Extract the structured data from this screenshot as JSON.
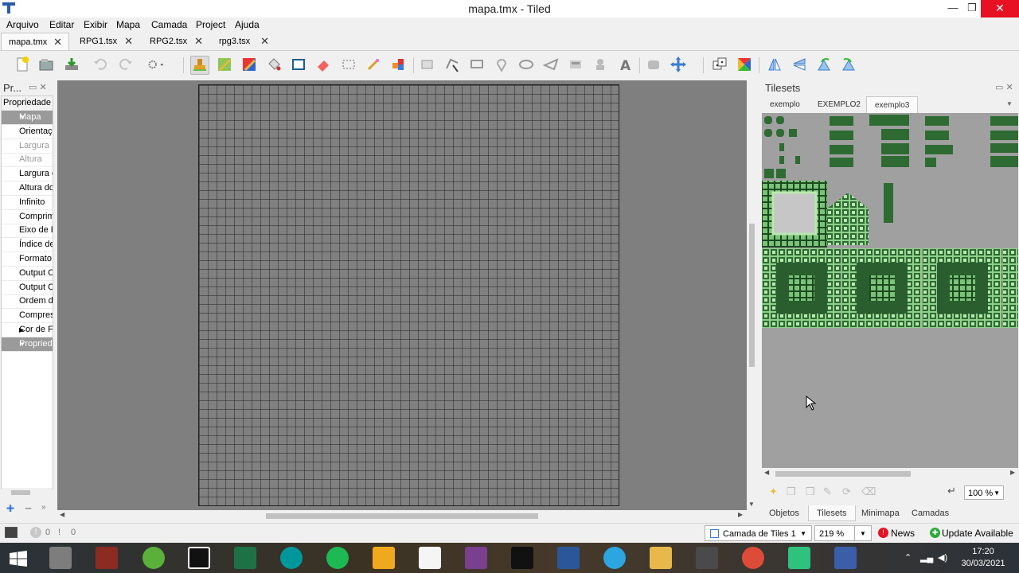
{
  "window": {
    "title": "mapa.tmx - Tiled",
    "controls": [
      "minimize-icon",
      "maximize-icon",
      "close-icon"
    ]
  },
  "menu": [
    "Arquivo",
    "Editar",
    "Exibir",
    "Mapa",
    "Camada",
    "Project",
    "Ajuda"
  ],
  "doc_tabs": [
    {
      "label": "mapa.tmx",
      "active": true
    },
    {
      "label": "RPG1.tsx",
      "active": false
    },
    {
      "label": "RPG2.tsx",
      "active": false
    },
    {
      "label": "rpg3.tsx",
      "active": false
    }
  ],
  "toolbar": {
    "icons": [
      "new-icon",
      "open-icon",
      "save-icon",
      "undo-icon",
      "redo-icon",
      "commands-icon",
      "stamp-brush-icon",
      "terrain-brush-icon",
      "wang-brush-icon",
      "bucket-fill-icon",
      "shape-fill-icon",
      "eraser-icon",
      "rect-select-icon",
      "magic-wand-icon",
      "select-same-tile-icon",
      "select-objects-icon",
      "edit-polygons-icon",
      "insert-rectangle-icon",
      "insert-point-icon",
      "insert-ellipse-icon",
      "insert-polygon-icon",
      "insert-tile-icon",
      "insert-template-icon",
      "insert-text-icon",
      "random-mode-icon",
      "wang-fill-mode-icon",
      "flip-horizontal-icon",
      "flip-vertical-icon",
      "rotate-left-icon",
      "rotate-right-icon"
    ],
    "selected": "stamp-brush-icon"
  },
  "properties_panel": {
    "title": "Pr...",
    "header": "Propriedade",
    "rows": [
      {
        "label": "Mapa",
        "kind": "group"
      },
      {
        "label": "Orientaç",
        "kind": "prop"
      },
      {
        "label": "Largura",
        "kind": "dim"
      },
      {
        "label": "Altura",
        "kind": "dim"
      },
      {
        "label": "Largura d",
        "kind": "prop"
      },
      {
        "label": "Altura do",
        "kind": "prop"
      },
      {
        "label": "Infinito",
        "kind": "prop"
      },
      {
        "label": "Comprim",
        "kind": "prop"
      },
      {
        "label": "Eixo de E",
        "kind": "prop"
      },
      {
        "label": "Índice de",
        "kind": "prop"
      },
      {
        "label": "Formato",
        "kind": "prop"
      },
      {
        "label": "Output C",
        "kind": "prop"
      },
      {
        "label": "Output C",
        "kind": "prop"
      },
      {
        "label": "Ordem d",
        "kind": "prop"
      },
      {
        "label": "Compres",
        "kind": "prop"
      },
      {
        "label": "Cor de F",
        "kind": "prop"
      },
      {
        "label": "Propried",
        "kind": "group"
      }
    ]
  },
  "tilesets_panel": {
    "title": "Tilesets",
    "tabs": [
      {
        "label": "exemplo",
        "active": false
      },
      {
        "label": "EXEMPLO2",
        "active": false
      },
      {
        "label": "exemplo3",
        "active": true
      }
    ],
    "zoom": "100 %"
  },
  "dock_tabs": [
    {
      "label": "Objetos",
      "active": false
    },
    {
      "label": "Tilesets",
      "active": true
    },
    {
      "label": "Minimapa",
      "active": false
    },
    {
      "label": "Camadas",
      "active": false
    }
  ],
  "statusbar": {
    "errors": "0",
    "warnings": "0",
    "layer": "Camada de Tiles 1",
    "zoom": "219 %",
    "news": "News",
    "update": "Update Available"
  },
  "taskbar": {
    "apps": [
      "start-icon",
      "app-icon",
      "app-icon",
      "utorrent-icon",
      "app-icon",
      "excel-icon",
      "arduino-icon",
      "spotify-icon",
      "app-icon",
      "file-icon",
      "winrar-icon",
      "epic-games-icon",
      "word-icon",
      "telegram-icon",
      "file-explorer-icon",
      "media-player-icon",
      "chrome-icon",
      "app-icon",
      "tiled-icon"
    ],
    "time": "17:20",
    "date": "30/03/2021"
  },
  "colors": {
    "canvas_bg": "#7f7f7f",
    "tile_green": "#8fd08a",
    "tile_dark": "#1b4a1e",
    "close_red": "#e81123"
  }
}
